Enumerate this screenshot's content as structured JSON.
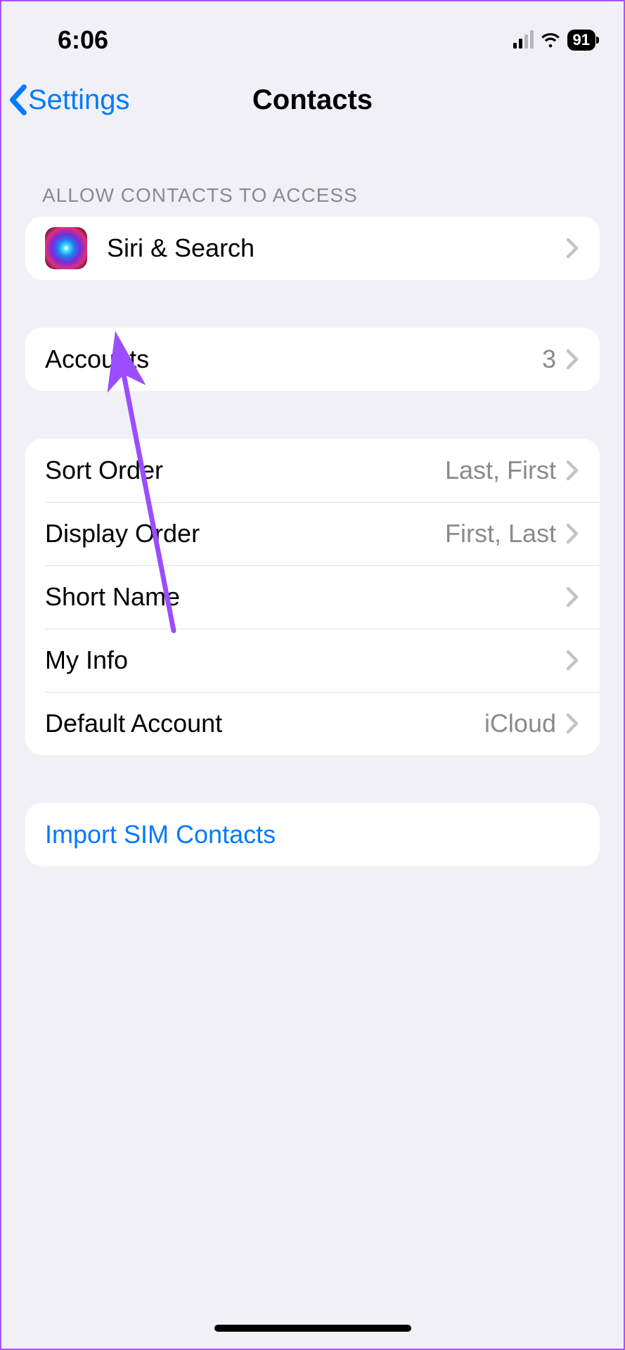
{
  "status": {
    "time": "6:06",
    "battery": "91"
  },
  "nav": {
    "back_label": "Settings",
    "title": "Contacts"
  },
  "section_allow_header": "ALLOW CONTACTS TO ACCESS",
  "rows": {
    "siri": {
      "label": "Siri & Search"
    },
    "accounts": {
      "label": "Accounts",
      "value": "3"
    },
    "sort_order": {
      "label": "Sort Order",
      "value": "Last, First"
    },
    "display_order": {
      "label": "Display Order",
      "value": "First, Last"
    },
    "short_name": {
      "label": "Short Name"
    },
    "my_info": {
      "label": "My Info"
    },
    "default_account": {
      "label": "Default Account",
      "value": "iCloud"
    },
    "import_sim": {
      "label": "Import SIM Contacts"
    }
  }
}
